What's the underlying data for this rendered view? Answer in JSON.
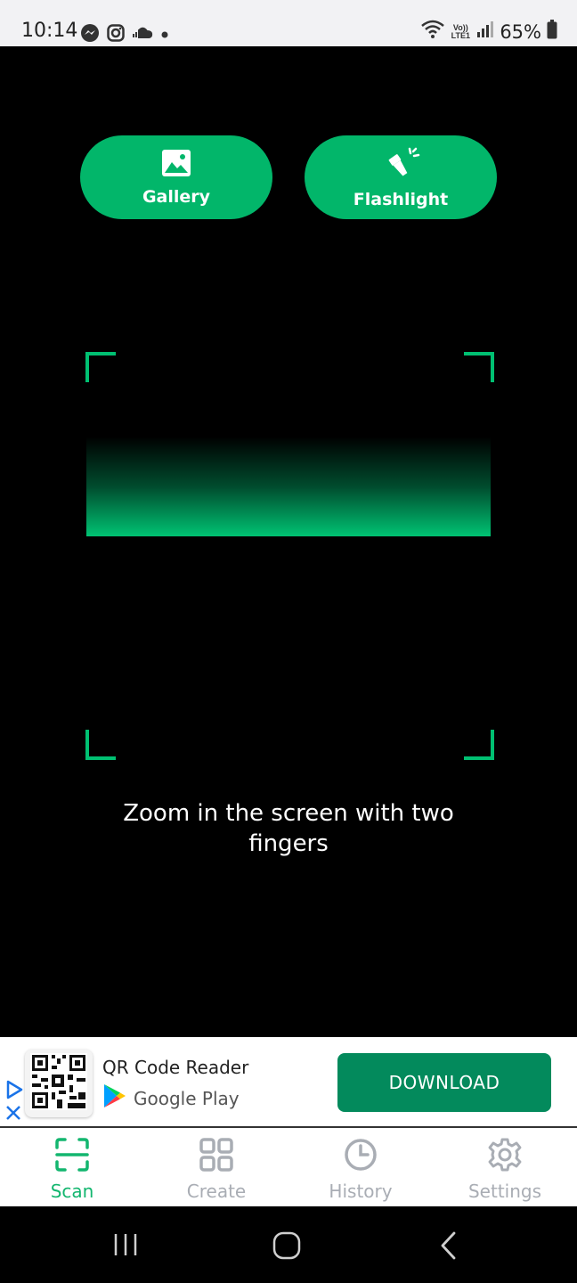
{
  "status_bar": {
    "time": "10:14",
    "battery": "65%",
    "notification_icons": [
      "messenger-icon",
      "instagram-icon",
      "soundcloud-icon",
      "dot-icon"
    ],
    "system_icons": [
      "wifi-icon",
      "volte-icon",
      "signal-icon",
      "battery-icon"
    ],
    "volte_text": "Vo)) LTE1"
  },
  "top_buttons": {
    "gallery_label": "Gallery",
    "flashlight_label": "Flashlight"
  },
  "scanner": {
    "hint": "Zoom in the screen with two fingers",
    "accent_color": "#00c072"
  },
  "ad": {
    "title": "QR Code Reader",
    "store": "Google Play",
    "cta": "DOWNLOAD",
    "cta_color": "#038a5c"
  },
  "bottom_nav": {
    "items": [
      {
        "label": "Scan",
        "icon": "scan-icon",
        "active": true
      },
      {
        "label": "Create",
        "icon": "grid-icon",
        "active": false
      },
      {
        "label": "History",
        "icon": "clock-icon",
        "active": false
      },
      {
        "label": "Settings",
        "icon": "gear-icon",
        "active": false
      }
    ],
    "active_color": "#13b66f",
    "inactive_color": "#a9adb4"
  },
  "system_nav": [
    "recents-button",
    "home-button",
    "back-button"
  ]
}
